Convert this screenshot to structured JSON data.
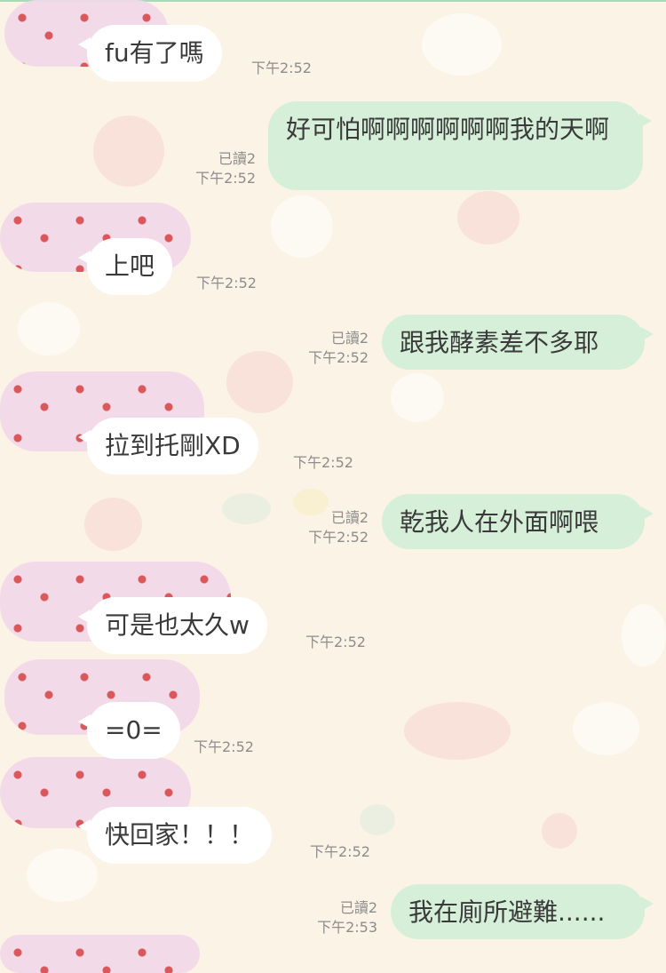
{
  "theme": {
    "background": "#fbf3e6",
    "incoming_bubble": "#ffffff",
    "outgoing_bubble": "#d6efd8",
    "text": "#3a3a3a",
    "meta": "#8d8d8d"
  },
  "messages": [
    {
      "direction": "in",
      "text": "fu有了嗎",
      "time": "下午2:52"
    },
    {
      "direction": "out",
      "text": "好可怕啊啊啊啊啊啊我的天啊",
      "read": "已讀2",
      "time": "下午2:52"
    },
    {
      "direction": "in",
      "text": "上吧",
      "time": "下午2:52"
    },
    {
      "direction": "out",
      "text": "跟我酵素差不多耶",
      "read": "已讀2",
      "time": "下午2:52"
    },
    {
      "direction": "in",
      "text": "拉到托剛XD",
      "time": "下午2:52"
    },
    {
      "direction": "out",
      "text": "乾我人在外面啊喂",
      "read": "已讀2",
      "time": "下午2:52"
    },
    {
      "direction": "in",
      "text": "可是也太久w",
      "time": "下午2:52"
    },
    {
      "direction": "in",
      "text": "=0=",
      "time": "下午2:52"
    },
    {
      "direction": "in",
      "text": "快回家！！！",
      "time": "下午2:52"
    },
    {
      "direction": "out",
      "text": "我在廁所避難......",
      "read": "已讀2",
      "time": "下午2:53"
    }
  ]
}
